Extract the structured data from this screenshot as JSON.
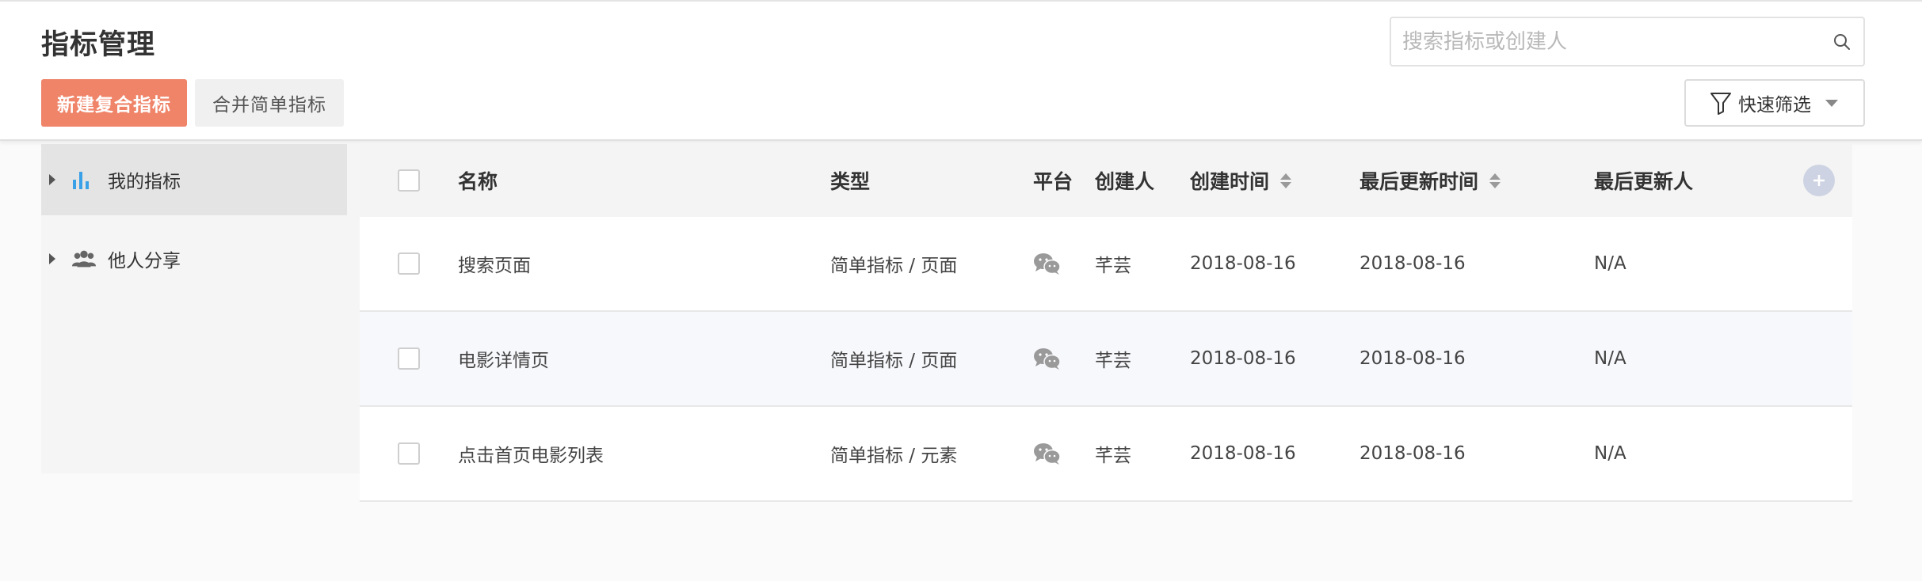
{
  "header": {
    "title": "指标管理",
    "new_composite_label": "新建复合指标",
    "merge_simple_label": "合并简单指标",
    "search_placeholder": "搜索指标或创建人",
    "filter_label": "快速筛选"
  },
  "colors": {
    "accent": "#ef8469",
    "sidebar_active": "#e4e4e4",
    "chart_icon": "#3aa0e8"
  },
  "sidebar": {
    "items": [
      {
        "label": "我的指标",
        "icon": "bar-chart-icon",
        "active": true
      },
      {
        "label": "他人分享",
        "icon": "users-icon",
        "active": false
      }
    ]
  },
  "table": {
    "columns": {
      "name": "名称",
      "type": "类型",
      "platform": "平台",
      "creator": "创建人",
      "created_at": "创建时间",
      "updated_at": "最后更新时间",
      "updated_by": "最后更新人"
    },
    "rows": [
      {
        "name": "搜索页面",
        "type": "简单指标 / 页面",
        "platform": "wechat-icon",
        "creator": "芊芸",
        "created_at": "2018-08-16",
        "updated_at": "2018-08-16",
        "updated_by": "N/A"
      },
      {
        "name": "电影详情页",
        "type": "简单指标 / 页面",
        "platform": "wechat-icon",
        "creator": "芊芸",
        "created_at": "2018-08-16",
        "updated_at": "2018-08-16",
        "updated_by": "N/A"
      },
      {
        "name": "点击首页电影列表",
        "type": "简单指标 / 元素",
        "platform": "wechat-icon",
        "creator": "芊芸",
        "created_at": "2018-08-16",
        "updated_at": "2018-08-16",
        "updated_by": "N/A"
      }
    ]
  }
}
